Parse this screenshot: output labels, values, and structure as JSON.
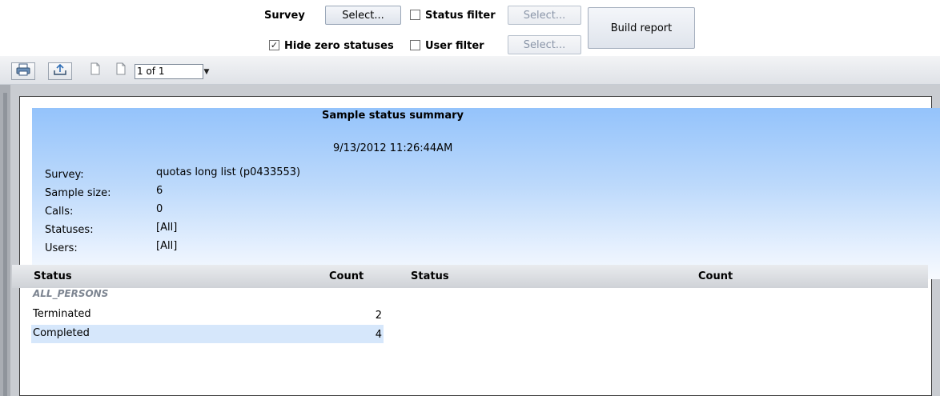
{
  "filters": {
    "survey_label": "Survey",
    "survey_button": "Select...",
    "status_filter_label": "Status filter",
    "status_filter_button": "Select...",
    "hide_zero_label": "Hide zero statuses",
    "hide_zero_checked": "✓",
    "user_filter_label": "User filter",
    "user_filter_button": "Select...",
    "build_report": "Build report"
  },
  "viewer": {
    "page_indicator": "1 of 1"
  },
  "report": {
    "title": "Sample status summary",
    "timestamp": "9/13/2012  11:26:44AM",
    "meta": [
      {
        "label": "Survey:",
        "value": "quotas long list (p0433553)"
      },
      {
        "label": "Sample size:",
        "value": "6"
      },
      {
        "label": "Calls:",
        "value": "0"
      },
      {
        "label": "Statuses:",
        "value": "[All]"
      },
      {
        "label": "Users:",
        "value": "[All]"
      }
    ],
    "columns": [
      "Status",
      "Count",
      "Status",
      "Count"
    ],
    "group": "ALL_PERSONS",
    "rows": [
      {
        "status": "Terminated",
        "count": "2"
      },
      {
        "status": "Completed",
        "count": "4"
      }
    ]
  }
}
